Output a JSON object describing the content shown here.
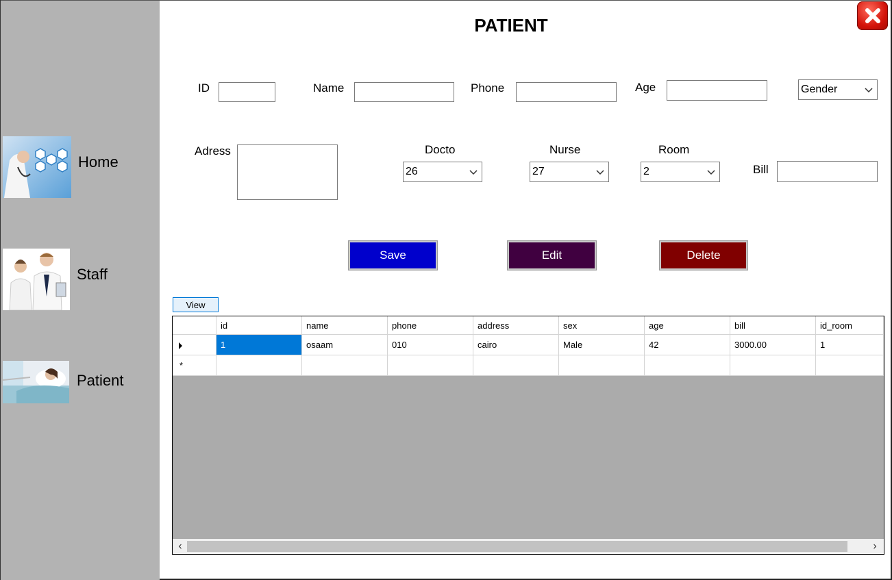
{
  "sidebar": {
    "items": [
      {
        "label": "Home",
        "icon": "doctor-medical-icons-image"
      },
      {
        "label": "Staff",
        "icon": "medical-staff-image"
      },
      {
        "label": "Patient",
        "icon": "patient-in-bed-image"
      }
    ]
  },
  "header": {
    "title": "PATIENT",
    "close_icon": "close-icon"
  },
  "form": {
    "id_label": "ID",
    "name_label": "Name",
    "phone_label": "Phone",
    "age_label": "Age",
    "gender_value": "Gender",
    "address_label": "Adress",
    "doctor_label": "Docto",
    "doctor_value": "26",
    "nurse_label": "Nurse",
    "nurse_value": "27",
    "room_label": "Room",
    "room_value": "2",
    "bill_label": "Bill",
    "id_value": "",
    "name_value": "",
    "phone_value": "",
    "age_value": "",
    "address_value": "",
    "bill_value": ""
  },
  "buttons": {
    "save": "Save",
    "edit": "Edit",
    "delete": "Delete",
    "view": "View"
  },
  "colors": {
    "save": "#0000cc",
    "edit": "#400040",
    "delete": "#800000",
    "sidebar": "#b3b3b3",
    "selection": "#0078d7",
    "grid_background": "#ababab"
  },
  "table": {
    "columns": [
      "id",
      "name",
      "phone",
      "address",
      "sex",
      "age",
      "bill",
      "id_room"
    ],
    "rows": [
      [
        "1",
        "osaam",
        "010",
        "cairo",
        "Male",
        "42",
        "3000.00",
        "1"
      ]
    ],
    "new_row_marker": "*"
  },
  "scrollbar": {
    "left_arrow": "‹",
    "right_arrow": "›"
  }
}
